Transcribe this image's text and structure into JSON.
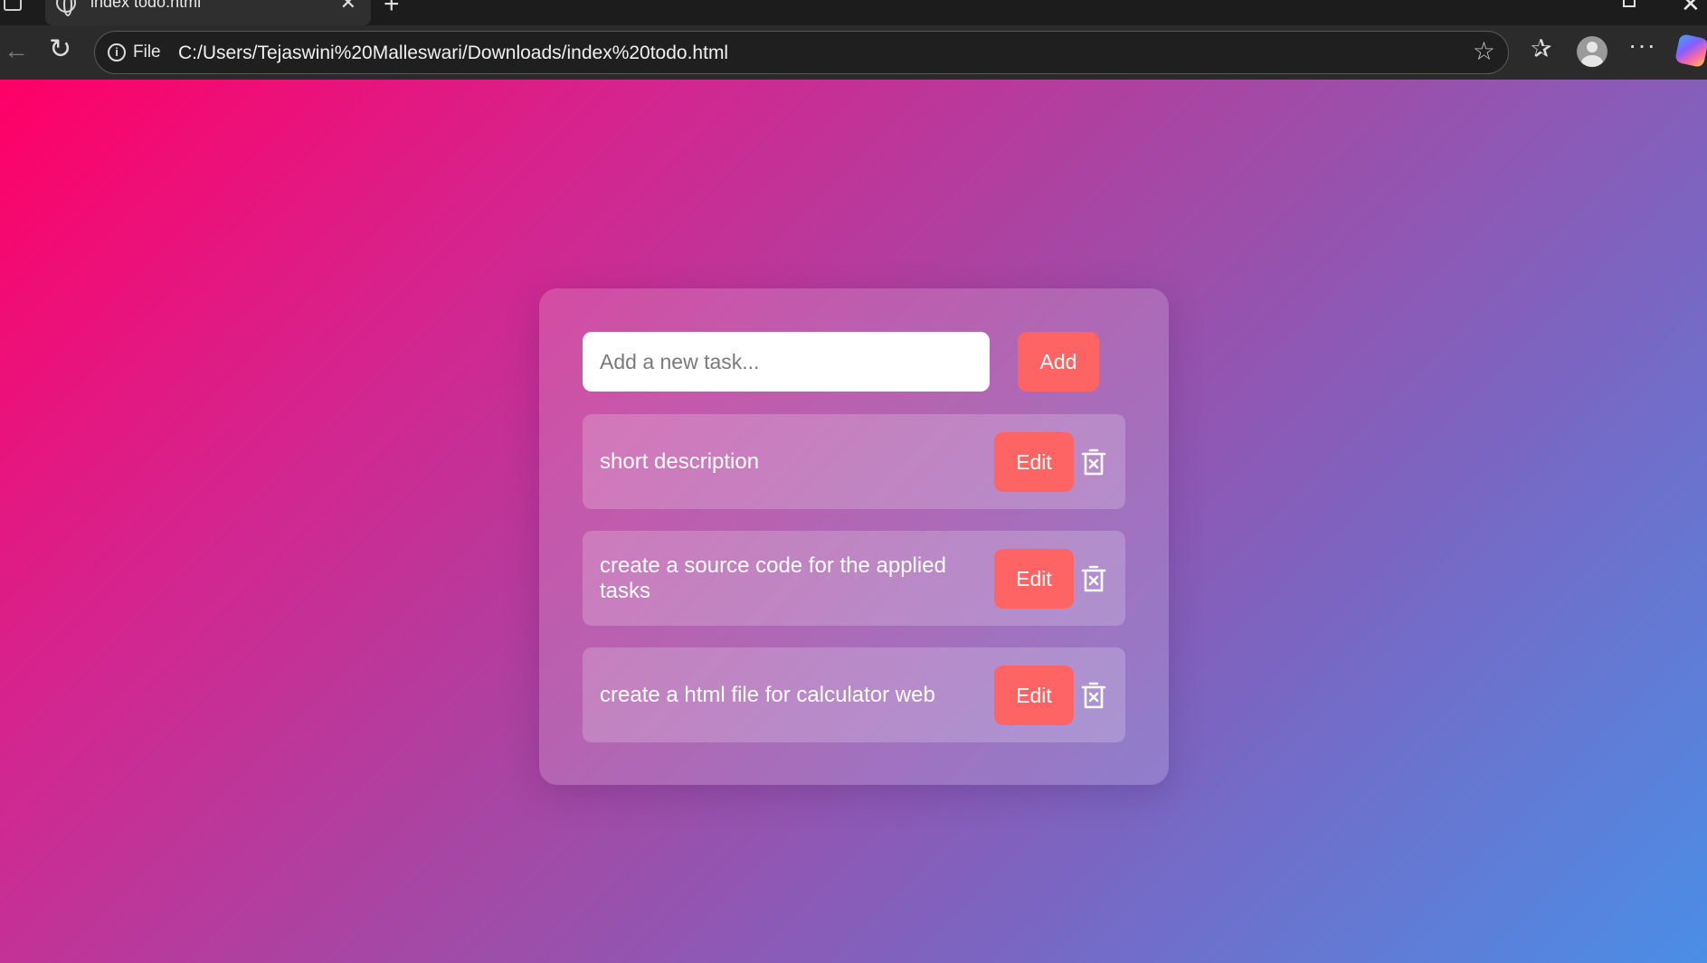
{
  "browser": {
    "tab_title": "index todo.html",
    "tab_close_glyph": "✕",
    "new_tab_glyph": "+",
    "window_close_glyph": "✕",
    "back_glyph": "←",
    "reload_glyph": "↻",
    "info_glyph": "i",
    "address_scheme_label": "File",
    "url": "C:/Users/Tejaswini%20Malleswari/Downloads/index%20todo.html",
    "star_glyph": "☆",
    "favorites_glyph": "✰",
    "more_glyph": "···"
  },
  "todo": {
    "input_placeholder": "Add a new task...",
    "add_label": "Add",
    "edit_label": "Edit",
    "tasks": [
      {
        "text": "short description"
      },
      {
        "text": "create a source code for the applied tasks"
      },
      {
        "text": "create a html file for calculator web"
      }
    ]
  },
  "colors": {
    "accent_button": "#ff6464",
    "gradient_start": "#ff0066",
    "gradient_end": "#4a8ee6"
  },
  "icons": {
    "delete": "trash-icon",
    "tab": "globe-icon",
    "security": "info-icon"
  }
}
